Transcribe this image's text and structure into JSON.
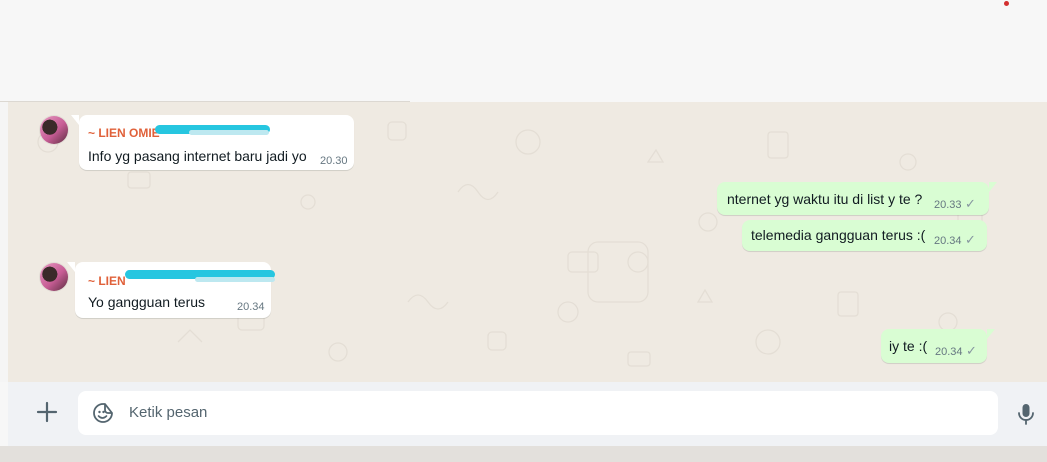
{
  "chat": {
    "messages": [
      {
        "direction": "in",
        "sender": "~ LIEN OMIE",
        "text": "Info yg pasang internet baru jadi yo",
        "time": "20.30",
        "sender_redacted": true
      },
      {
        "direction": "out",
        "text": "nternet yg waktu itu di list y te ?",
        "time": "20.33",
        "status": "sent-check-icon"
      },
      {
        "direction": "out",
        "text": "telemedia gangguan terus :(",
        "time": "20.34",
        "status": "sent-check-icon"
      },
      {
        "direction": "in",
        "sender": "~ LIEN",
        "text": "Yo gangguan terus",
        "time": "20.34",
        "sender_redacted": true
      },
      {
        "direction": "out",
        "text": "iy te :(",
        "time": "20.34",
        "status": "sent-check-icon"
      }
    ]
  },
  "composer": {
    "placeholder": "Ketik pesan",
    "icons": [
      "plus-icon",
      "sticker-icon",
      "microphone-icon"
    ]
  },
  "colors": {
    "chat_background": "#efeae2",
    "incoming_bubble": "#ffffff",
    "outgoing_bubble": "#d9fdd3",
    "sender_name": "#e0613a",
    "redaction_scribble": "#26c6e0",
    "notification_dot": "#d32f2f"
  }
}
